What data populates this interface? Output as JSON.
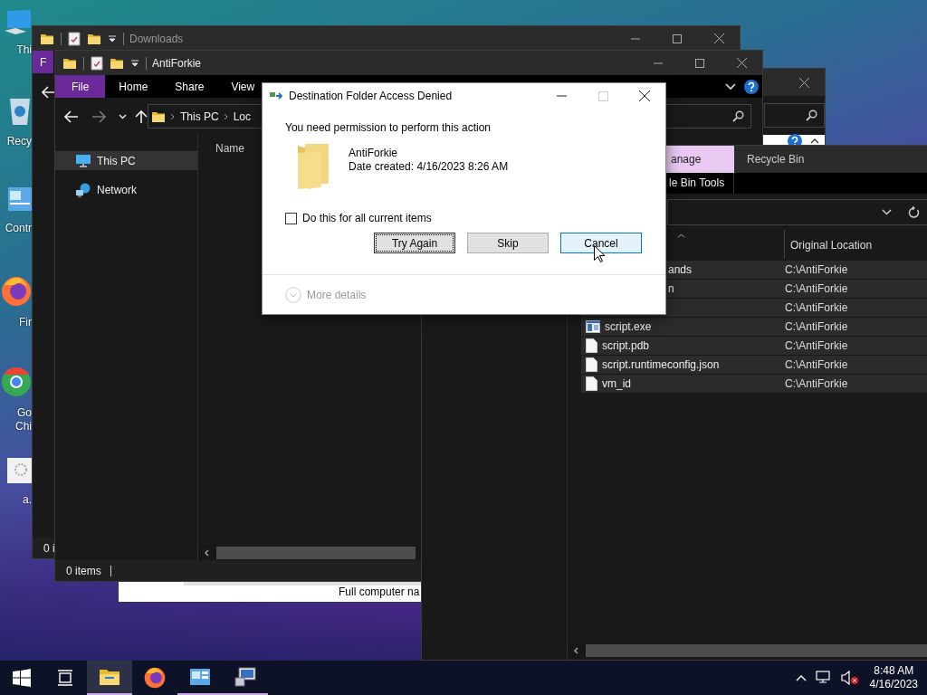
{
  "desktop_icons": [
    {
      "kind": "computer",
      "lines": [
        "Thi"
      ]
    },
    {
      "kind": "recycle-bin",
      "lines": [
        "Recy"
      ]
    },
    {
      "kind": "control-panel",
      "lines": [
        "Contr"
      ]
    },
    {
      "kind": "firefox",
      "lines": [
        "Fir"
      ]
    },
    {
      "kind": "chrome",
      "lines": [
        "Go",
        "Chi"
      ]
    },
    {
      "kind": "document",
      "lines": [
        "a."
      ]
    }
  ],
  "system_window": {
    "footer_text": "Full computer na"
  },
  "downloads_window": {
    "title": "Downloads",
    "ribbon_tab": "F",
    "status": "0 i"
  },
  "explorer_window": {
    "title": "AntiForkie",
    "ribbon_tabs": [
      {
        "label": "File",
        "kind": "file"
      },
      {
        "label": "Home",
        "kind": "tab"
      },
      {
        "label": "Share",
        "kind": "tab"
      },
      {
        "label": "View",
        "kind": "tab"
      }
    ],
    "breadcrumb": [
      "This PC",
      "Loc"
    ],
    "nav_items": [
      {
        "label": "This PC",
        "kind": "computer",
        "selected": true
      },
      {
        "label": "Network",
        "kind": "network",
        "selected": false
      }
    ],
    "column": "Name",
    "status": "0 items"
  },
  "recycle_window": {
    "ribbon_tabs": [
      {
        "label": "anage",
        "kind": "context"
      },
      {
        "label": "Recycle Bin",
        "kind": "tab"
      }
    ],
    "tools_label": "le Bin Tools",
    "column": "Original Location",
    "rows": [
      {
        "kind": "clipped",
        "name": "ands",
        "location": "C:\\AntiForkie"
      },
      {
        "kind": "clipped",
        "name": "n",
        "location": "C:\\AntiForkie"
      },
      {
        "kind": "hidden",
        "location": "C:\\AntiForkie"
      },
      {
        "kind": "app",
        "name": "script.exe",
        "location": "C:\\AntiForkie"
      },
      {
        "kind": "file",
        "name": "script.pdb",
        "location": "C:\\AntiForkie"
      },
      {
        "kind": "file",
        "name": "script.runtimeconfig.json",
        "location": "C:\\AntiForkie"
      },
      {
        "kind": "file",
        "name": "vm_id",
        "location": "C:\\AntiForkie"
      }
    ]
  },
  "dialog": {
    "title": "Destination Folder Access Denied",
    "maximize_disabled": true,
    "message": "You need permission to perform this action",
    "item_name": "AntiForkie",
    "item_detail": "Date created: 4/16/2023 8:26 AM",
    "checkbox": {
      "label": "Do this for all current items",
      "checked": false
    },
    "buttons": [
      {
        "label": "Try Again",
        "focused": true,
        "hovered": false
      },
      {
        "label": "Skip",
        "focused": false,
        "hovered": false
      },
      {
        "label": "Cancel",
        "focused": false,
        "hovered": true
      }
    ],
    "more_details": "More details"
  },
  "taskbar": {
    "apps": [
      {
        "kind": "explorer",
        "running": true,
        "selected": true
      },
      {
        "kind": "firefox",
        "running": false,
        "selected": false
      },
      {
        "kind": "control-panel",
        "running": true,
        "selected": false
      },
      {
        "kind": "system",
        "running": true,
        "selected": false
      }
    ],
    "time": "8:48 AM",
    "date": "4/16/2023"
  }
}
